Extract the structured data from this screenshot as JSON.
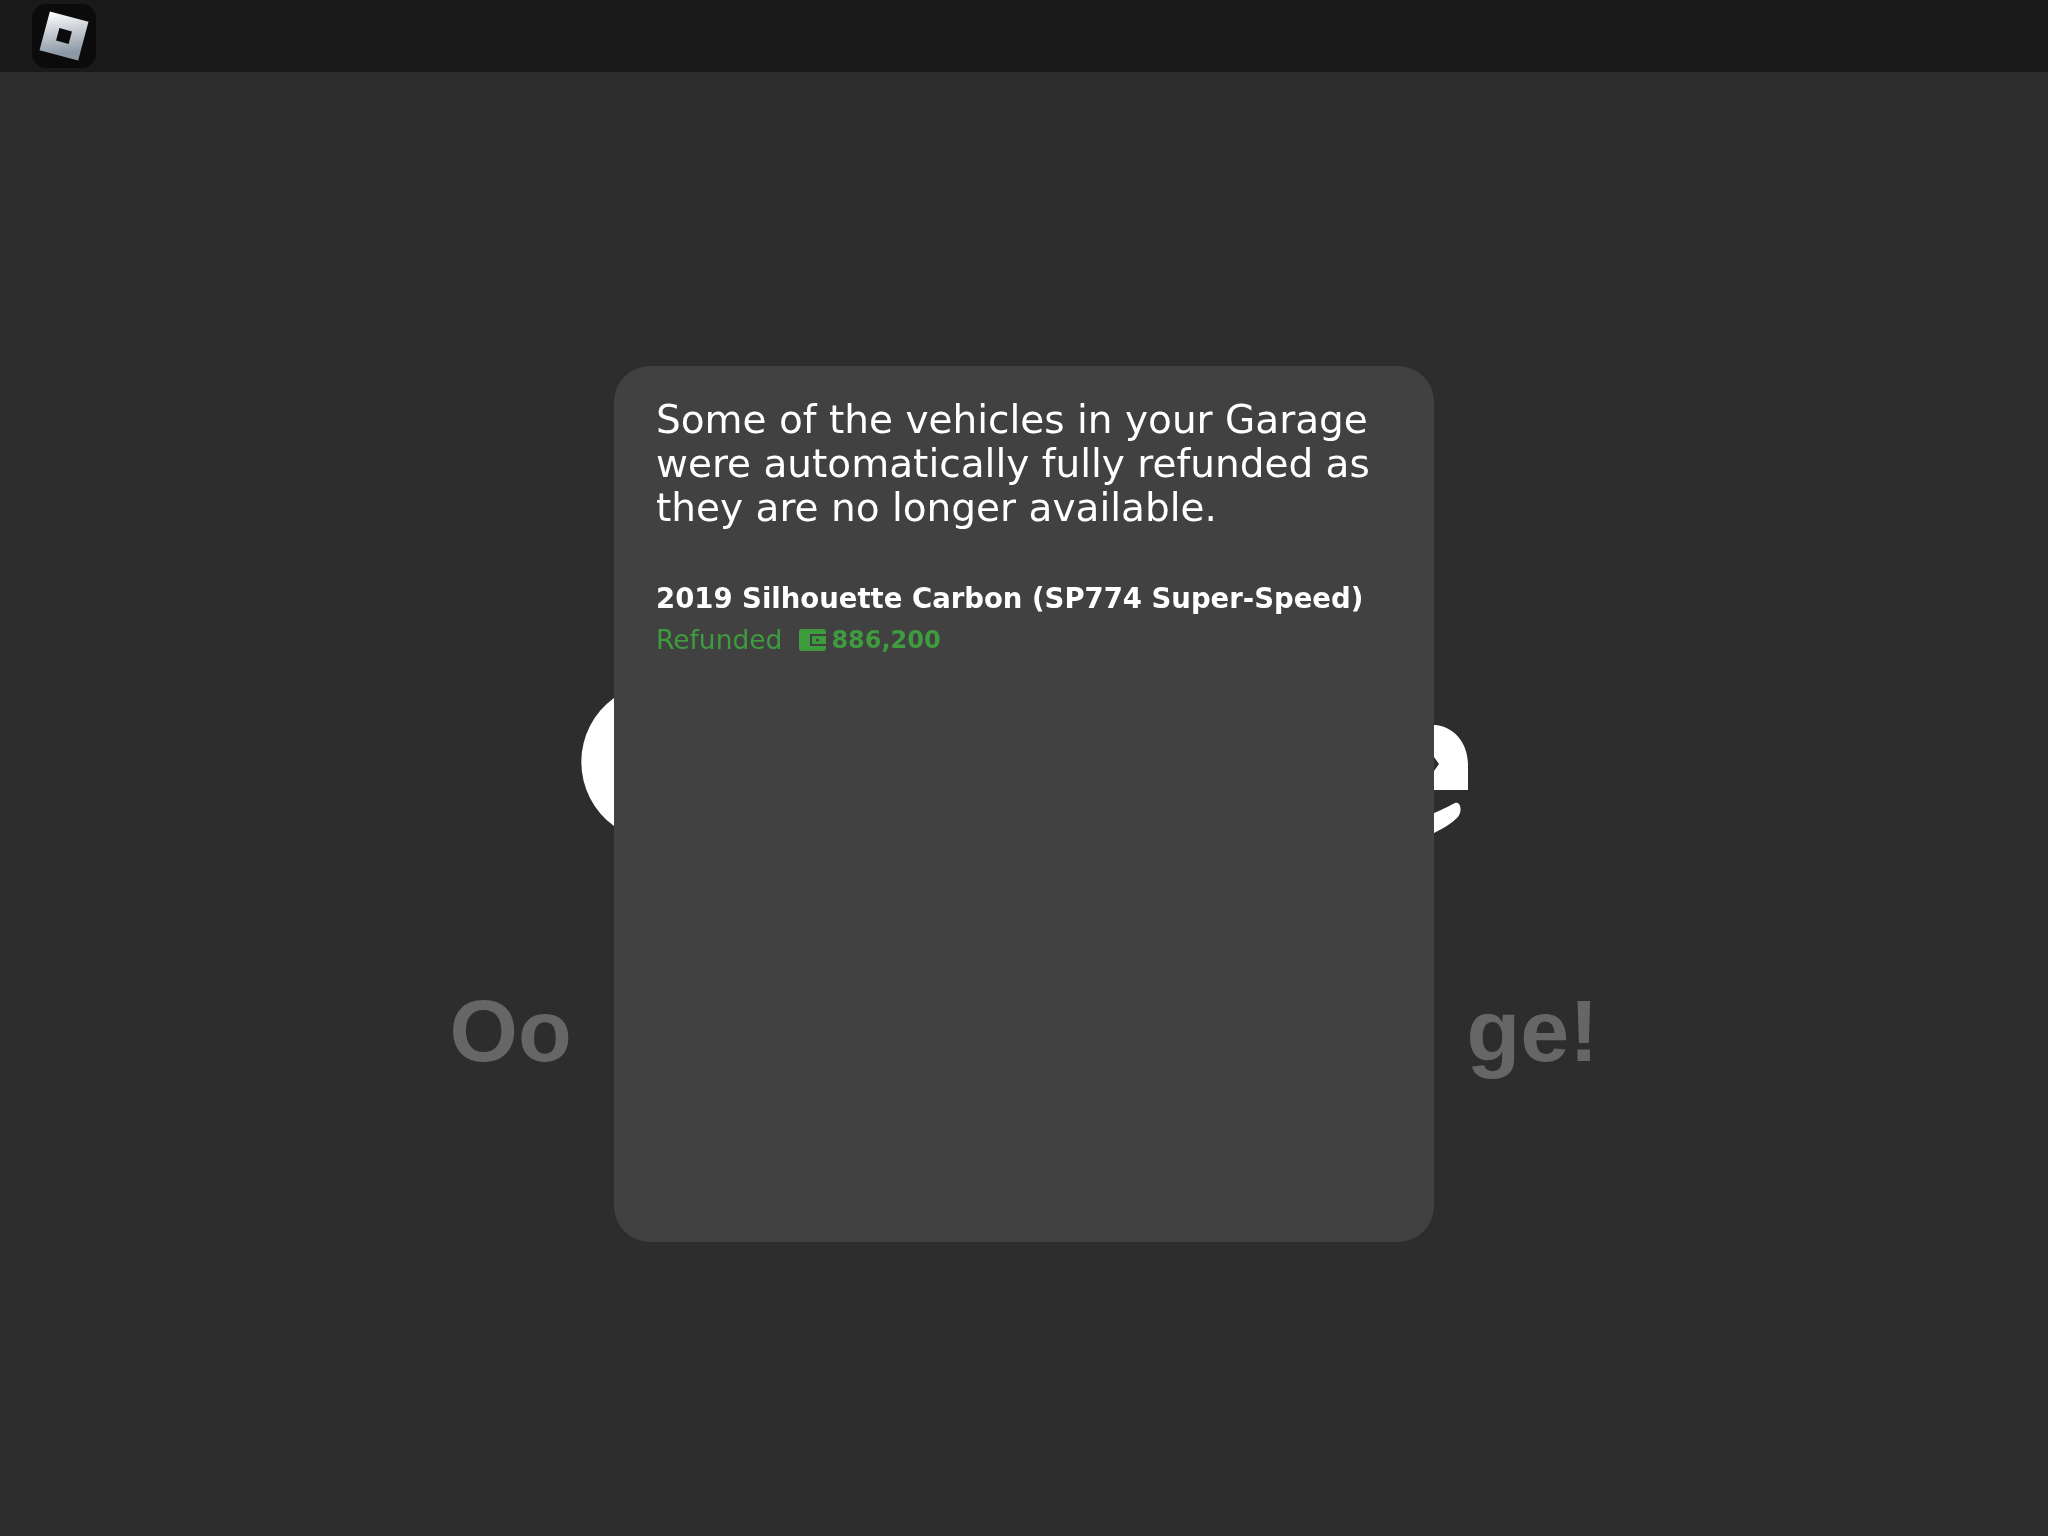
{
  "background": {
    "heading_fragments": [
      "Oo",
      "ge!"
    ]
  },
  "dialog": {
    "message": "Some of the vehicles in your Garage were automatically fully refunded as they are no longer available.",
    "items": [
      {
        "name": "2019 Silhouette Carbon (SP774 Super-Speed)",
        "status": "Refunded",
        "amount": "886,200"
      }
    ]
  }
}
